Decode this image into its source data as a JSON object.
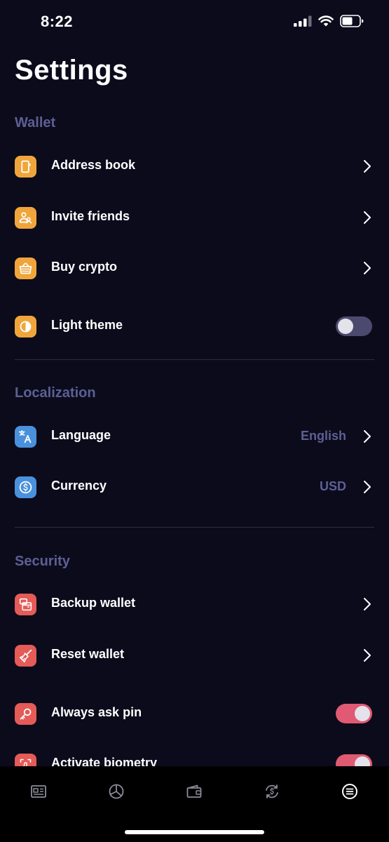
{
  "status_bar": {
    "time": "8:22",
    "icons": [
      "signal-icon",
      "wifi-icon",
      "battery-icon"
    ]
  },
  "page_title": "Settings",
  "sections": {
    "wallet": {
      "label": "Wallet",
      "items": [
        {
          "label": "Address book",
          "icon": "address-book-icon",
          "control": "chevron"
        },
        {
          "label": "Invite friends",
          "icon": "invite-friends-icon",
          "control": "chevron"
        },
        {
          "label": "Buy crypto",
          "icon": "basket-icon",
          "control": "chevron"
        },
        {
          "label": "Light theme",
          "icon": "theme-icon",
          "control": "toggle",
          "toggle_on": false
        }
      ]
    },
    "localization": {
      "label": "Localization",
      "items": [
        {
          "label": "Language",
          "value": "English",
          "icon": "language-icon",
          "control": "chevron"
        },
        {
          "label": "Currency",
          "value": "USD",
          "icon": "currency-icon",
          "control": "chevron"
        }
      ]
    },
    "security": {
      "label": "Security",
      "items": [
        {
          "label": "Backup wallet",
          "icon": "backup-icon",
          "control": "chevron"
        },
        {
          "label": "Reset wallet",
          "icon": "broom-icon",
          "control": "chevron"
        },
        {
          "label": "Always ask pin",
          "icon": "key-icon",
          "control": "toggle",
          "toggle_on": true
        },
        {
          "label": "Activate biometry",
          "icon": "fingerprint-icon",
          "control": "toggle",
          "toggle_on": true
        }
      ]
    }
  },
  "tab_bar": {
    "tabs": [
      {
        "icon": "news-icon",
        "active": false
      },
      {
        "icon": "portfolio-icon",
        "active": false
      },
      {
        "icon": "wallet-icon",
        "active": false
      },
      {
        "icon": "exchange-icon",
        "active": false
      },
      {
        "icon": "menu-icon",
        "active": true
      }
    ]
  },
  "colors": {
    "background": "#0c0b1c",
    "section_label": "#5d5f94",
    "icon_orange": "#f0a53b",
    "icon_blue": "#4a91dc",
    "icon_red": "#e45b57",
    "toggle_on": "#df5a72",
    "toggle_off": "#4b4a6e"
  }
}
